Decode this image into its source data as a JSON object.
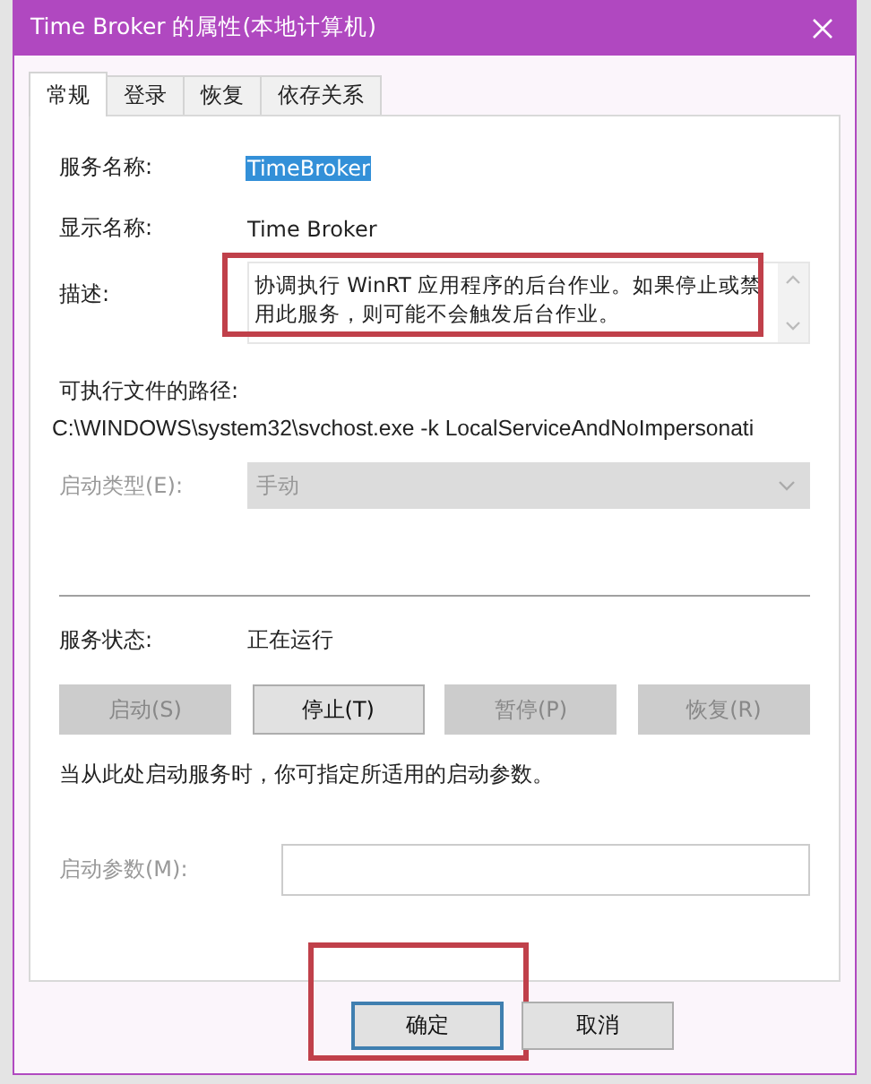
{
  "window": {
    "title": "Time Broker 的属性(本地计算机)"
  },
  "tabs": [
    {
      "label": "常规",
      "selected": true
    },
    {
      "label": "登录",
      "selected": false
    },
    {
      "label": "恢复",
      "selected": false
    },
    {
      "label": "依存关系",
      "selected": false
    }
  ],
  "service_name": {
    "label": "服务名称:",
    "value": "TimeBroker",
    "selected": true
  },
  "display_name": {
    "label": "显示名称:",
    "value": "Time Broker"
  },
  "description": {
    "label": "描述:",
    "value": "协调执行 WinRT 应用程序的后台作业。如果停止或禁用此服务，则可能不会触发后台作业。",
    "highlighted": true
  },
  "executable_path": {
    "label": "可执行文件的路径:",
    "value": "C:\\WINDOWS\\system32\\svchost.exe -k LocalServiceAndNoImpersonati"
  },
  "startup_type": {
    "label": "启动类型(E):",
    "value": "手动",
    "disabled": true
  },
  "service_status": {
    "label": "服务状态:",
    "value": "正在运行"
  },
  "service_buttons": [
    {
      "label": "启动(S)",
      "disabled": true
    },
    {
      "label": "停止(T)",
      "disabled": false
    },
    {
      "label": "暂停(P)",
      "disabled": true
    },
    {
      "label": "恢复(R)",
      "disabled": true
    }
  ],
  "hint": "当从此处启动服务时，你可指定所适用的启动参数。",
  "start_parameters": {
    "label": "启动参数(M):",
    "disabled": true
  },
  "dialog_buttons": [
    {
      "label": "确定",
      "default": true,
      "highlighted": true
    },
    {
      "label": "取消",
      "default": false,
      "highlighted": false
    }
  ]
}
